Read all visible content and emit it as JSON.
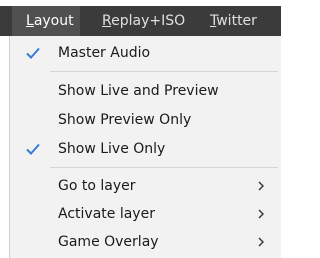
{
  "menubar": {
    "tabs": [
      {
        "label": "Layout",
        "mnemonic": "L",
        "rest": "ayout",
        "active": true
      },
      {
        "label": "Replay+ISO",
        "mnemonic": "R",
        "rest": "eplay+ISO",
        "active": false
      },
      {
        "label": "Twitter",
        "mnemonic": "T",
        "rest": "witter",
        "active": false
      }
    ]
  },
  "menu": {
    "items": [
      {
        "label": "Master Audio",
        "checked": true,
        "submenu": false
      },
      {
        "label": "Show Live and Preview",
        "checked": false,
        "submenu": false
      },
      {
        "label": "Show Preview Only",
        "checked": false,
        "submenu": false
      },
      {
        "label": "Show Live Only",
        "checked": true,
        "submenu": false
      },
      {
        "label": "Go to layer",
        "checked": false,
        "submenu": true
      },
      {
        "label": "Activate layer",
        "checked": false,
        "submenu": true
      },
      {
        "label": "Game Overlay",
        "checked": false,
        "submenu": true
      }
    ]
  },
  "icons": {
    "check": "checkmark-icon",
    "submenu": "chevron-right-icon"
  },
  "colors": {
    "menubar_bg": "#3b3b3b",
    "active_tab_bg": "#505050",
    "menu_bg": "#f2f2f2",
    "check_color": "#3a7bd5"
  }
}
